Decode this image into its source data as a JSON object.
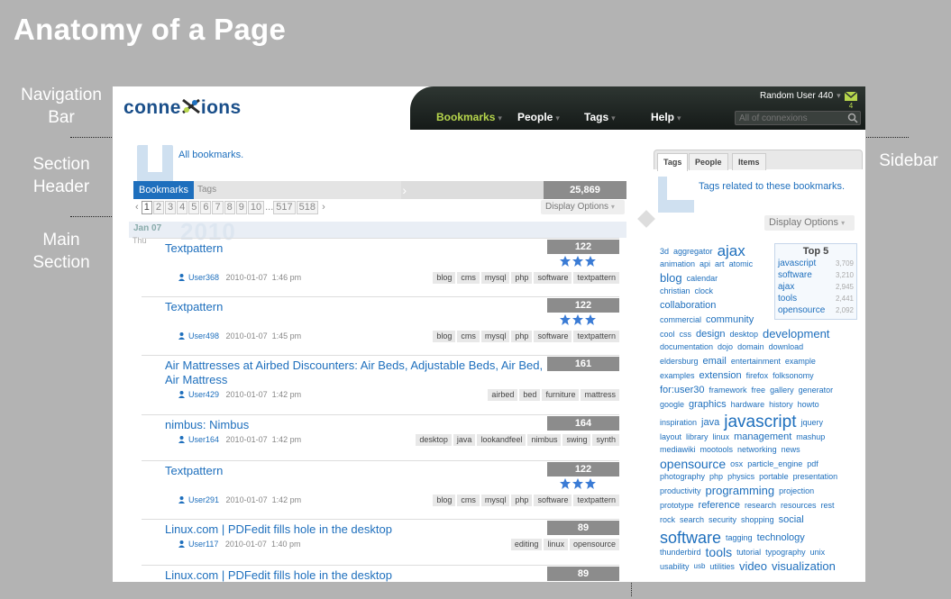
{
  "heading": "Anatomy of a Page",
  "annotations": {
    "nav_bar": "Navigation Bar",
    "section_header": "Section Header",
    "main_section": "Main Section",
    "sidebar": "Sidebar"
  },
  "nav": {
    "logo": "conne",
    "logo_tail": "ions",
    "items": [
      {
        "label": "Bookmarks",
        "active": true
      },
      {
        "label": "People"
      },
      {
        "label": "Tags"
      },
      {
        "label": "Help"
      }
    ],
    "user": "Random User 440",
    "mail_count": "4",
    "search_placeholder": "All of connexions"
  },
  "section": {
    "all_bookmarks": "All bookmarks.",
    "tab_bookmarks": "Bookmarks",
    "tab_tags": "Tags",
    "total": "25,869",
    "pagination": [
      "1",
      "2",
      "3",
      "4",
      "5",
      "6",
      "7",
      "8",
      "9",
      "10",
      "...",
      "517",
      "518"
    ],
    "prev": "‹",
    "next": "›",
    "current_page": "1",
    "display_options": "Display Options"
  },
  "date": {
    "label": "Jan 07",
    "year": "2010",
    "dow": "Thu"
  },
  "bookmarks": [
    {
      "title": "Textpattern",
      "count": "122",
      "stars": 3,
      "user": "User368",
      "date": "2010-01-07",
      "time": "1:46 pm",
      "tags": [
        "blog",
        "cms",
        "mysql",
        "php",
        "software",
        "textpattern"
      ]
    },
    {
      "title": "Textpattern",
      "count": "122",
      "stars": 3,
      "user": "User498",
      "date": "2010-01-07",
      "time": "1:45 pm",
      "tags": [
        "blog",
        "cms",
        "mysql",
        "php",
        "software",
        "textpattern"
      ]
    },
    {
      "title": "Air Mattresses at Airbed Discounters: Air Beds, Adjustable Beds, Air Bed, Air Mattress",
      "count": "161",
      "stars": 0,
      "user": "User429",
      "date": "2010-01-07",
      "time": "1:42 pm",
      "tags": [
        "airbed",
        "bed",
        "furniture",
        "mattress"
      ]
    },
    {
      "title": "nimbus: Nimbus",
      "count": "164",
      "stars": 0,
      "user": "User164",
      "date": "2010-01-07",
      "time": "1:42 pm",
      "tags": [
        "desktop",
        "java",
        "lookandfeel",
        "nimbus",
        "swing",
        "synth"
      ]
    },
    {
      "title": "Textpattern",
      "count": "122",
      "stars": 3,
      "user": "User291",
      "date": "2010-01-07",
      "time": "1:42 pm",
      "tags": [
        "blog",
        "cms",
        "mysql",
        "php",
        "software",
        "textpattern"
      ]
    },
    {
      "title": "Linux.com | PDFedit fills hole in the desktop",
      "count": "89",
      "stars": 0,
      "user": "User117",
      "date": "2010-01-07",
      "time": "1:40 pm",
      "tags": [
        "editing",
        "linux",
        "opensource"
      ]
    },
    {
      "title": "Linux.com | PDFedit fills hole in the desktop",
      "count": "89",
      "stars": 0,
      "user": "",
      "date": "",
      "time": "",
      "tags": []
    }
  ],
  "sidebar": {
    "tabs": [
      "Tags",
      "People",
      "Items"
    ],
    "related": "Tags related to these bookmarks.",
    "display_options": "Display Options",
    "top5_title": "Top 5",
    "top5": [
      {
        "tag": "javascript",
        "n": "3,709"
      },
      {
        "tag": "software",
        "n": "3,210"
      },
      {
        "tag": "ajax",
        "n": "2,945"
      },
      {
        "tag": "tools",
        "n": "2,441"
      },
      {
        "tag": "opensource",
        "n": "2,092"
      }
    ],
    "cloud_lines": [
      [
        [
          "3d",
          9
        ],
        [
          "aggregator",
          9
        ],
        [
          "ajax",
          17
        ]
      ],
      [
        [
          "animation",
          9
        ],
        [
          "api",
          9
        ],
        [
          "art",
          9
        ],
        [
          "atomic",
          9
        ]
      ],
      [
        [
          "blog",
          13
        ],
        [
          "calendar",
          9
        ]
      ],
      [
        [
          "christian",
          9
        ],
        [
          "clock",
          9
        ]
      ],
      [
        [
          "collaboration",
          11
        ]
      ],
      [
        [
          "commercial",
          9
        ],
        [
          "community",
          11
        ]
      ],
      [
        [
          "cool",
          9
        ],
        [
          "css",
          9
        ],
        [
          "design",
          11
        ],
        [
          "desktop",
          9
        ],
        [
          "development",
          13
        ]
      ],
      [
        [
          "documentation",
          9
        ],
        [
          "dojo",
          9
        ],
        [
          "domain",
          9
        ],
        [
          "download",
          9
        ]
      ],
      [
        [
          "eldersburg",
          9
        ],
        [
          "email",
          11
        ],
        [
          "entertainment",
          9
        ],
        [
          "example",
          9
        ]
      ],
      [
        [
          "examples",
          9
        ],
        [
          "extension",
          11
        ],
        [
          "firefox",
          9
        ],
        [
          "folksonomy",
          9
        ]
      ],
      [
        [
          "for:user30",
          11
        ],
        [
          "framework",
          9
        ],
        [
          "free",
          9
        ],
        [
          "gallery",
          9
        ],
        [
          "generator",
          9
        ]
      ],
      [
        [
          "google",
          9
        ],
        [
          "graphics",
          11
        ],
        [
          "hardware",
          9
        ],
        [
          "history",
          9
        ],
        [
          "howto",
          9
        ]
      ],
      [
        [
          "inspiration",
          9
        ],
        [
          "java",
          11
        ],
        [
          "javascript",
          19
        ],
        [
          "jquery",
          9
        ]
      ],
      [
        [
          "layout",
          9
        ],
        [
          "library",
          9
        ],
        [
          "linux",
          9
        ],
        [
          "management",
          11
        ],
        [
          "mashup",
          9
        ]
      ],
      [
        [
          "mediawiki",
          9
        ],
        [
          "mootools",
          9
        ],
        [
          "networking",
          9
        ],
        [
          "news",
          9
        ]
      ],
      [
        [
          "opensource",
          14
        ],
        [
          "osx",
          9
        ],
        [
          "particle_engine",
          9
        ],
        [
          "pdf",
          9
        ]
      ],
      [
        [
          "photography",
          9
        ],
        [
          "php",
          9
        ],
        [
          "physics",
          9
        ],
        [
          "portable",
          9
        ],
        [
          "presentation",
          9
        ]
      ],
      [
        [
          "productivity",
          9
        ],
        [
          "programming",
          13
        ],
        [
          "projection",
          9
        ]
      ],
      [
        [
          "prototype",
          9
        ],
        [
          "reference",
          11
        ],
        [
          "research",
          9
        ],
        [
          "resources",
          9
        ],
        [
          "rest",
          9
        ]
      ],
      [
        [
          "rock",
          9
        ],
        [
          "search",
          9
        ],
        [
          "security",
          9
        ],
        [
          "shopping",
          9
        ],
        [
          "social",
          11
        ]
      ],
      [
        [
          "software",
          18
        ],
        [
          "tagging",
          9
        ],
        [
          "technology",
          11
        ]
      ],
      [
        [
          "thunderbird",
          9
        ],
        [
          "tools",
          14
        ],
        [
          "tutorial",
          9
        ],
        [
          "typography",
          9
        ],
        [
          "unix",
          9
        ]
      ],
      [
        [
          "usability",
          9
        ],
        [
          "usb",
          8
        ],
        [
          "utilities",
          9
        ],
        [
          "video",
          13
        ],
        [
          "visualization",
          13
        ]
      ]
    ]
  }
}
